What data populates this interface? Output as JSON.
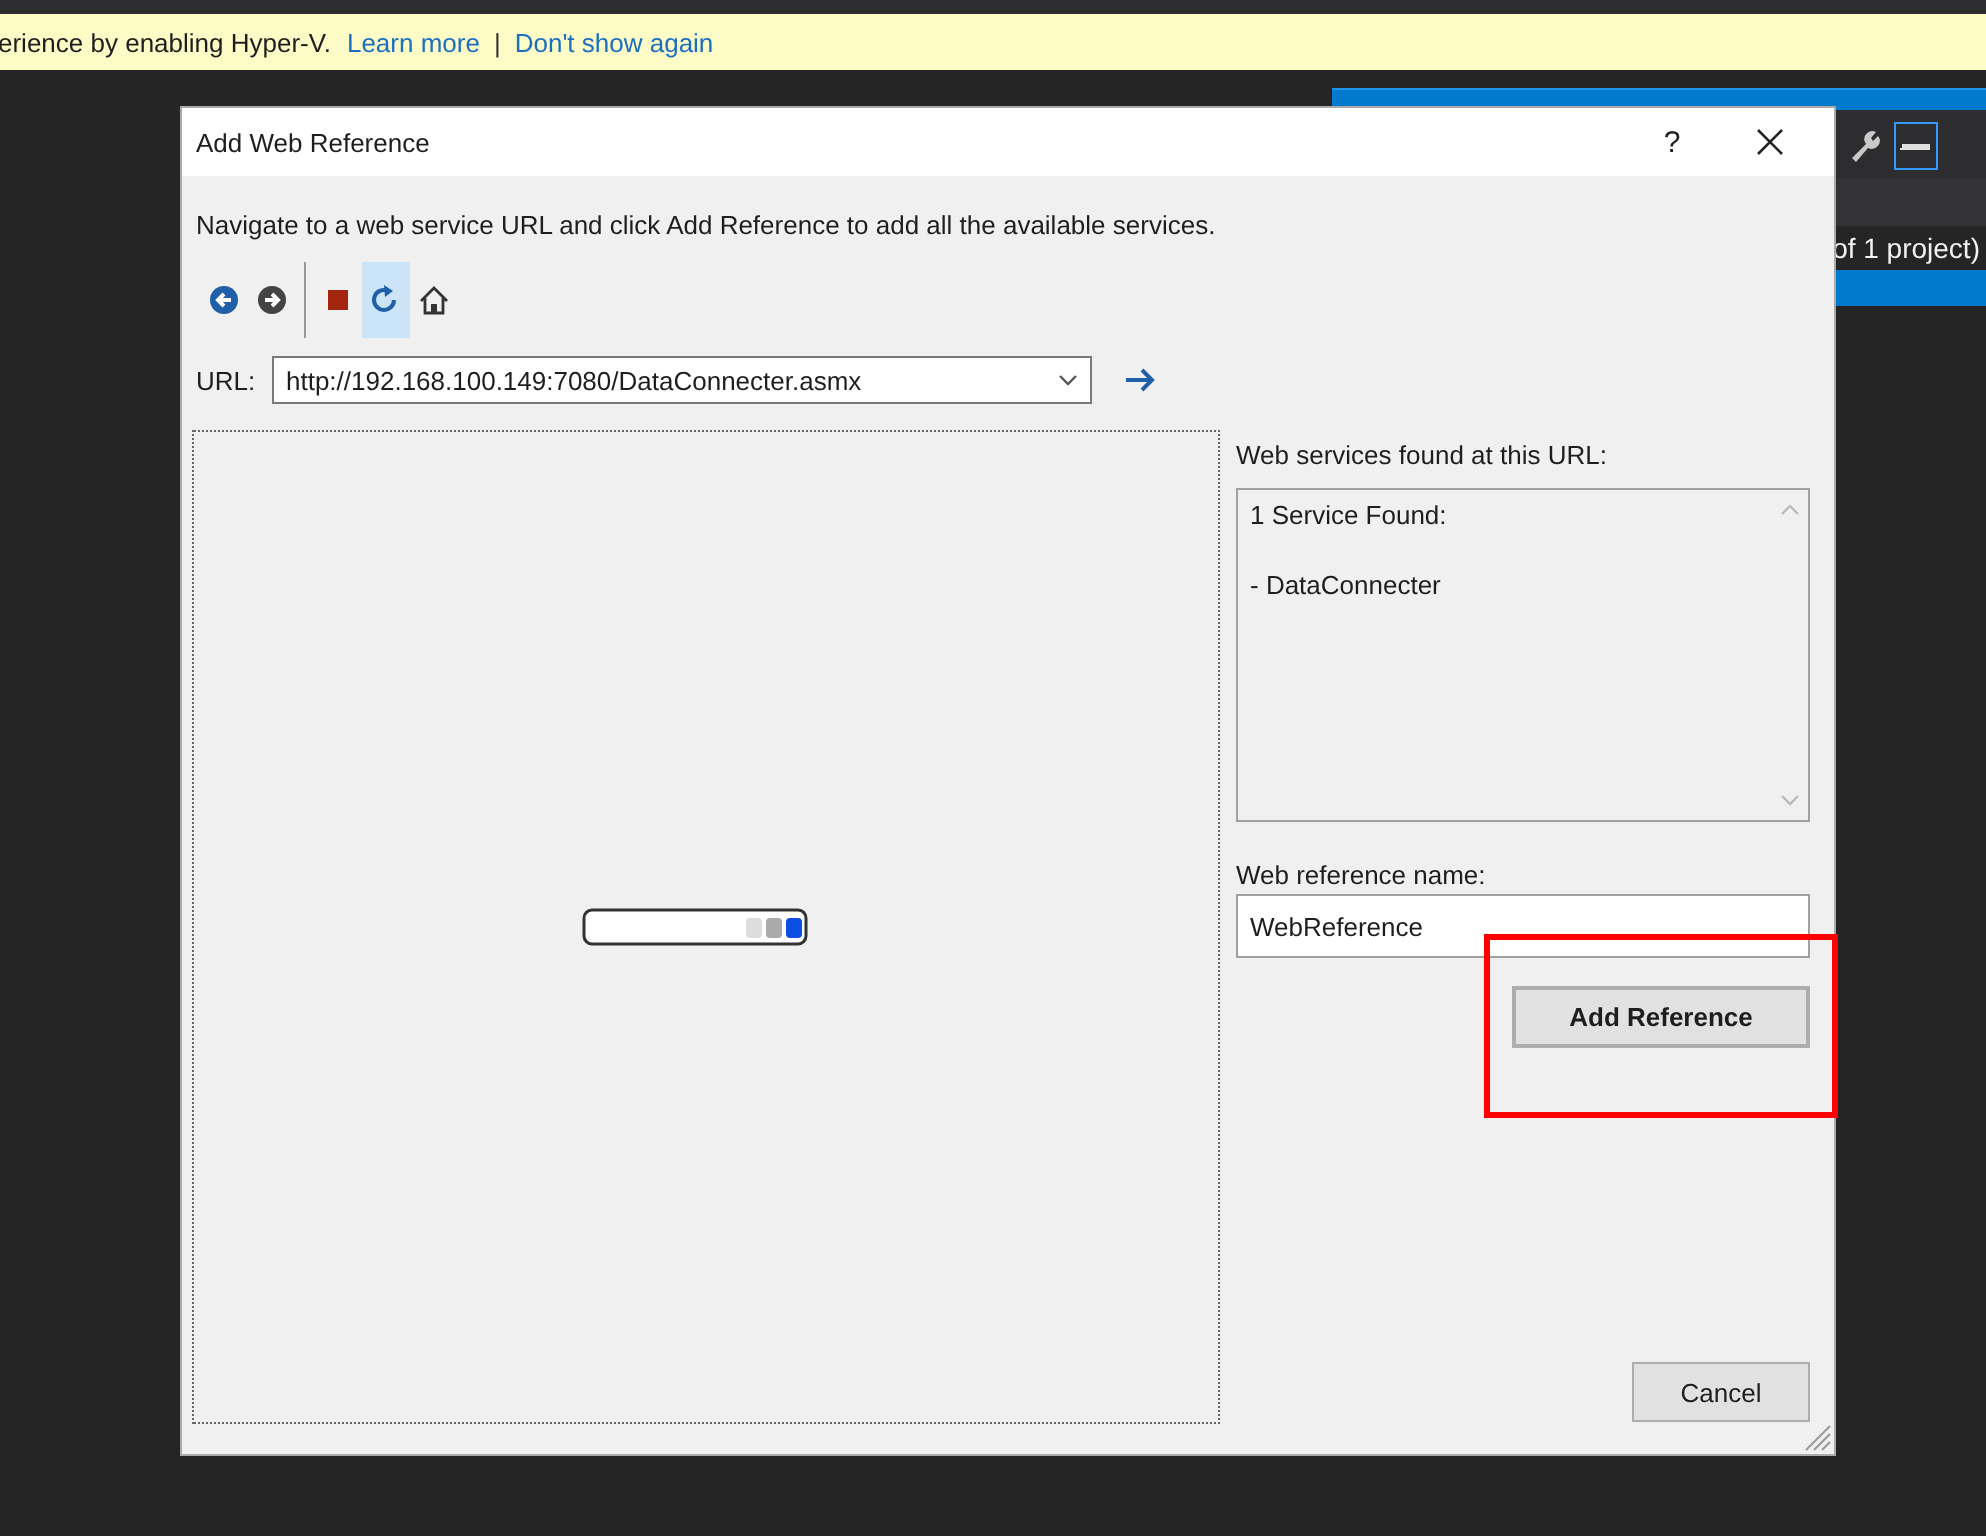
{
  "infobar": {
    "message": "erience by enabling Hyper-V.",
    "links": [
      "Learn more",
      "Don't show again"
    ],
    "separator": "|"
  },
  "solution_explorer": {
    "status": "of 1 project)"
  },
  "dialog": {
    "title": "Add Web Reference",
    "help": "?",
    "instruction": "Navigate to a web service URL and click Add Reference to add all the available services.",
    "toolbar": [
      {
        "kind": "back",
        "selected": false
      },
      {
        "kind": "forward",
        "selected": false
      },
      {
        "kind": "stop",
        "selected": false
      },
      {
        "kind": "refresh",
        "selected": true
      },
      {
        "kind": "home",
        "selected": false
      }
    ],
    "url": {
      "label": "URL:",
      "value": "http://192.168.100.149:7080/DataConnecter.asmx"
    },
    "services": {
      "label": "Web services found at this URL:",
      "heading": "1 Service Found:",
      "items": [
        "- DataConnecter"
      ]
    },
    "reference_name": {
      "label": "Web reference name:",
      "value": "WebReference"
    },
    "buttons": [
      {
        "label": "Add Reference",
        "kind": "primary",
        "highlighted": true
      },
      {
        "label": "Cancel",
        "kind": "normal",
        "highlighted": false
      }
    ]
  }
}
